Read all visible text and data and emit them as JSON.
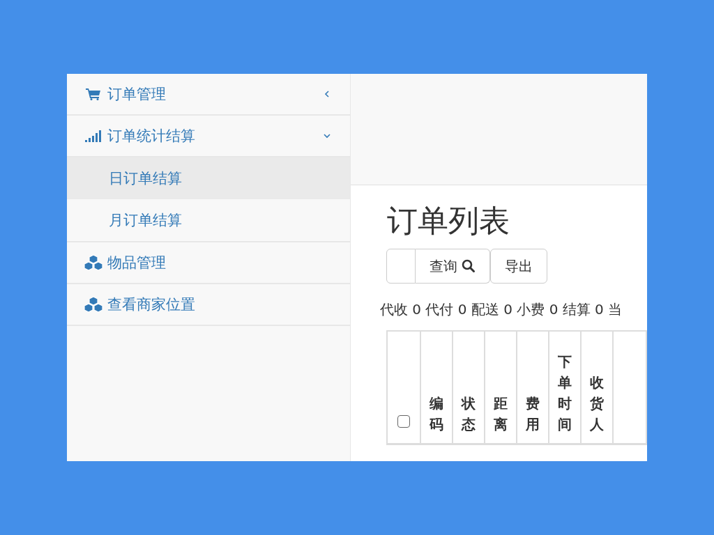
{
  "sidebar": {
    "items": [
      {
        "label": "订单管理",
        "expanded": false
      },
      {
        "label": "订单统计结算",
        "expanded": true,
        "children": [
          {
            "label": "日订单结算",
            "selected": true
          },
          {
            "label": "月订单结算",
            "selected": false
          }
        ]
      },
      {
        "label": "物品管理"
      },
      {
        "label": "查看商家位置"
      }
    ]
  },
  "main": {
    "title": "订单列表",
    "buttons": [
      {
        "kind": "blank"
      },
      {
        "kind": "search",
        "label": "查询"
      },
      {
        "kind": "plain",
        "label": "导出"
      }
    ],
    "summary": "代收 0 代付 0 配送 0 小费 0 结算 0 当",
    "table": {
      "select_all_checked": false,
      "columns": [
        "编码",
        "状态",
        "距离",
        "费用",
        "下单时间",
        "收货人",
        ""
      ]
    }
  }
}
